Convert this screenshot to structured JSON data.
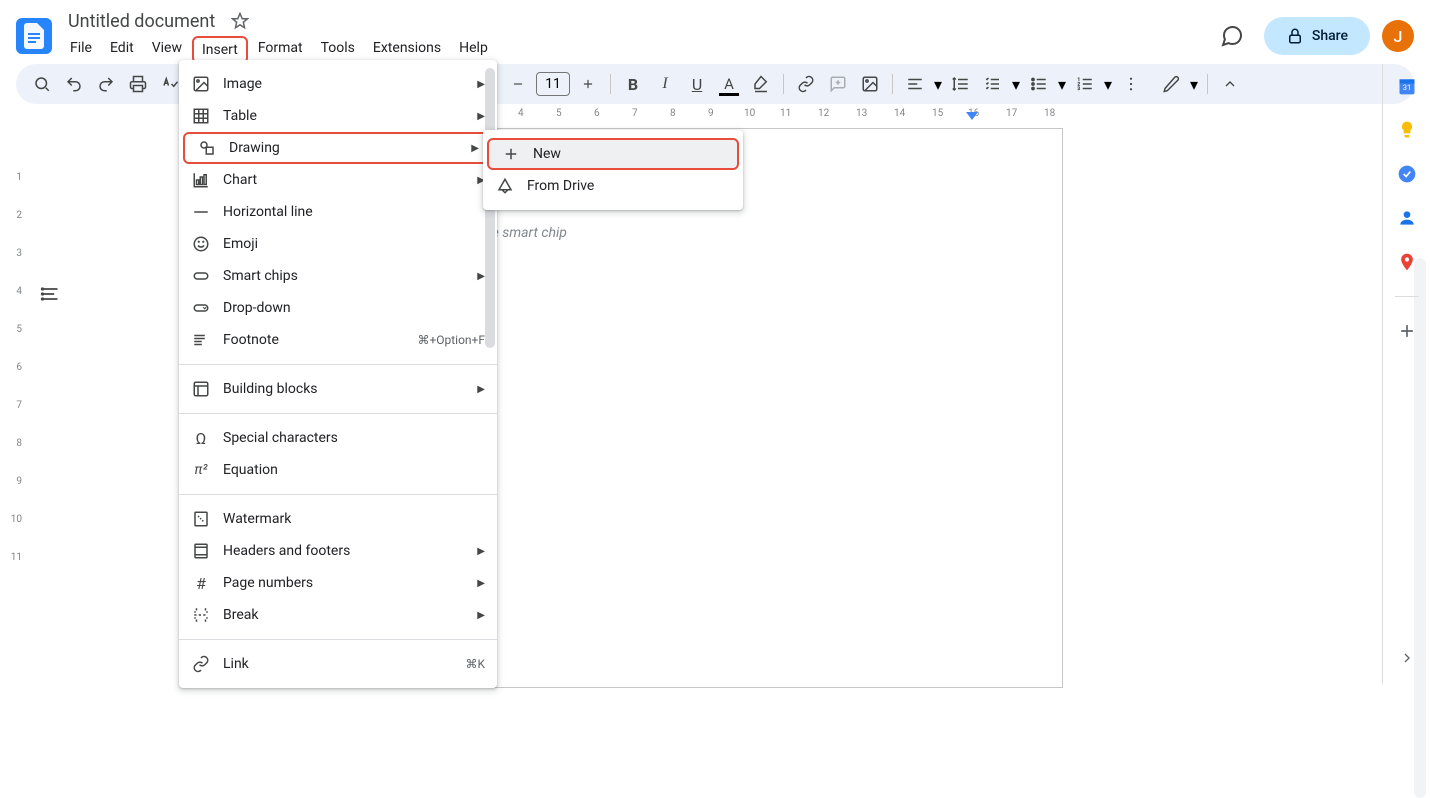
{
  "doc_title": "Untitled document",
  "menubar": [
    "File",
    "Edit",
    "View",
    "Insert",
    "Format",
    "Tools",
    "Extensions",
    "Help"
  ],
  "active_menu_index": 3,
  "share_label": "Share",
  "avatar_letter": "J",
  "font_size": "11",
  "ruler_top": [
    "4",
    "5",
    "6",
    "7",
    "8",
    "9",
    "10",
    "11",
    "12",
    "13",
    "14",
    "15",
    "16",
    "17",
    "18"
  ],
  "ruler_left": [
    "1",
    "2",
    "3",
    "4",
    "5",
    "6",
    "7",
    "8",
    "9",
    "10",
    "11"
  ],
  "doc_placeholder": "Type @ to insert a people smart chip",
  "insert_menu": {
    "image": "Image",
    "table": "Table",
    "drawing": "Drawing",
    "chart": "Chart",
    "horizontal_line": "Horizontal line",
    "emoji": "Emoji",
    "smart_chips": "Smart chips",
    "dropdown": "Drop-down",
    "footnote": "Footnote",
    "footnote_shortcut": "⌘+Option+F",
    "building_blocks": "Building blocks",
    "special_chars": "Special characters",
    "equation": "Equation",
    "watermark": "Watermark",
    "headers_footers": "Headers and footers",
    "page_numbers": "Page numbers",
    "break": "Break",
    "link": "Link",
    "link_shortcut": "⌘K"
  },
  "drawing_submenu": {
    "new": "New",
    "from_drive": "From Drive"
  }
}
